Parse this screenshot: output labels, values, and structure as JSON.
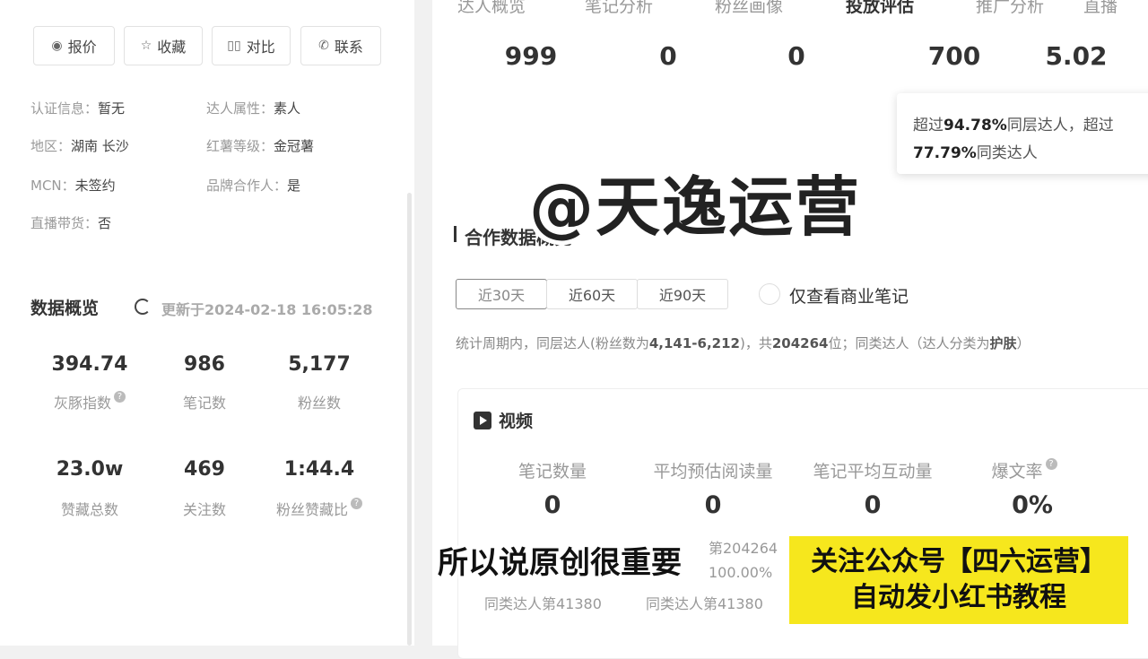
{
  "actions": [
    {
      "icon": "price-icon",
      "glyph": "◉",
      "label": "报价"
    },
    {
      "icon": "star-icon",
      "glyph": "☆",
      "label": "收藏"
    },
    {
      "icon": "compare-icon",
      "glyph": "▯▯",
      "label": "对比"
    },
    {
      "icon": "phone-icon",
      "glyph": "✆",
      "label": "联系"
    }
  ],
  "profile": {
    "cert_key": "认证信息：",
    "cert_val": "暂无",
    "attr_key": "达人属性：",
    "attr_val": "素人",
    "region_key": "地区：",
    "region_val": "湖南 长沙",
    "level_key": "红薯等级：",
    "level_val": "金冠薯",
    "mcn_key": "MCN：",
    "mcn_val": "未签约",
    "brand_key": "品牌合作人：",
    "brand_val": "是",
    "live_key": "直播带货：",
    "live_val": "否"
  },
  "overview": {
    "title": "数据概览",
    "updated": "更新于2024-02-18 16:05:28",
    "stats": [
      {
        "value": "394.74",
        "label": "灰豚指数",
        "help": true
      },
      {
        "value": "986",
        "label": "笔记数",
        "help": false
      },
      {
        "value": "5,177",
        "label": "粉丝数",
        "help": false
      },
      {
        "value": "23.0w",
        "label": "赞藏总数",
        "help": false
      },
      {
        "value": "469",
        "label": "关注数",
        "help": false
      },
      {
        "value": "1:44.4",
        "label": "粉丝赞藏比",
        "help": true
      }
    ]
  },
  "top_tabs": [
    "达人概览",
    "笔记分析",
    "粉丝画像",
    "投放评估",
    "推广分析",
    "直播"
  ],
  "top_values": [
    "999",
    "0",
    "0",
    "700",
    "5.02"
  ],
  "tooltip": {
    "line1_pre": "超过",
    "line1_pct": "94.78%",
    "line1_post": "同层达人，超过",
    "line2_pct": "77.79%",
    "line2_post": "同类达人"
  },
  "coop": {
    "title": "合作数据概览",
    "ranges": [
      "近30天",
      "近60天",
      "近90天"
    ],
    "checkbox_label": "仅查看商业笔记",
    "period_a": "统计周期内，同层达人(粉丝数为",
    "period_b": "4,141-6,212",
    "period_c": ")，共",
    "period_d": "204264",
    "period_e": "位；同类达人（达人分类为",
    "period_f": "护肤",
    "period_g": "）"
  },
  "video": {
    "title": "视频",
    "metrics": [
      {
        "label": "笔记数量",
        "value": "0"
      },
      {
        "label": "平均预估阅读量",
        "value": "0"
      },
      {
        "label": "笔记平均互动量",
        "value": "0"
      },
      {
        "label": "爆文率",
        "value": "0%"
      }
    ],
    "rank_a": "第204264",
    "rank_b": "100.00%",
    "rank_c": "同类达人第41380",
    "rank_d": "同类达人第41380"
  },
  "overlay": {
    "watermark": "@天逸运营",
    "subtitle": "所以说原创很重要",
    "banner_line1": "关注公众号【四六运营】",
    "banner_line2": "自动发小红书教程"
  }
}
